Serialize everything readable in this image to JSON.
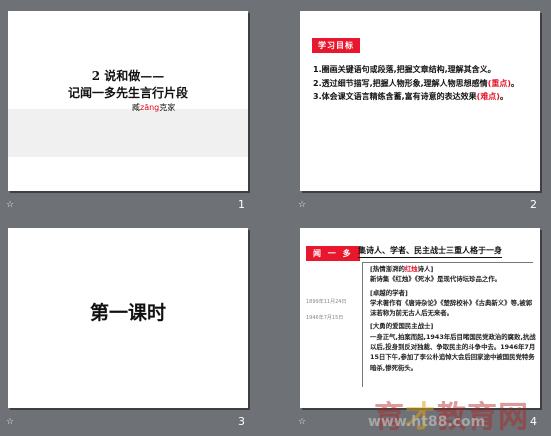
{
  "slides": [
    {
      "number": "1",
      "anim_icon": "animation-icon",
      "title_line1": "2 说和做——",
      "title_line2": "记闻一多先生言行片段",
      "author_prefix": "臧",
      "author_pinyin": "zāng",
      "author_name": "克家"
    },
    {
      "number": "2",
      "anim_icon": "animation-icon",
      "tag": "学习目标",
      "goals": [
        {
          "text": "1.圈画关键语句或段落,把握文章结构,理解其含义。",
          "red": ""
        },
        {
          "text": "2.透过细节描写,把握人物形象,理解人物思想感情",
          "red": "(重点)",
          "tail": "。"
        },
        {
          "text": "3.体会课文语言精练含蓄,富有诗意的表达效果",
          "red": "(难点)",
          "tail": "。"
        }
      ]
    },
    {
      "number": "3",
      "anim_icon": "animation-icon",
      "heading": "第一课时"
    },
    {
      "number": "4",
      "anim_icon": "animation-icon",
      "tag": "闻 一 多",
      "headline": "集诗人、学者、民主战士三重人格于一身",
      "section1_title_a": "[热情澎湃的",
      "section1_title_red": "红烛",
      "section1_title_b": "诗人]",
      "section1_text": "新诗集《红烛》《死水》是现代诗坛珍品之作。",
      "section2_title": "[卓越的学者]",
      "section2_text": "学术著作有《唐诗杂论》《楚辞校补》《古典新义》等,被郭沫若称为前无古人后无来者。",
      "section3_title": "[大勇的爱国民主战士]",
      "section3_text": "一身正气,拍案而起,1943年后目睹国民党政治的腐败,抗战以后,投身到反对独裁、争取民主的斗争中去。1946年7月15日下午,参加了李公朴追悼大会后回家途中被国民党特务暗杀,惨死街头。",
      "date1": "1899年11月24日",
      "date2": "1946年7月15日"
    }
  ],
  "watermark": {
    "line1_a": "育",
    "line1_b": "才",
    "line1_c": "教育网",
    "line2": "www.ht88.com"
  }
}
